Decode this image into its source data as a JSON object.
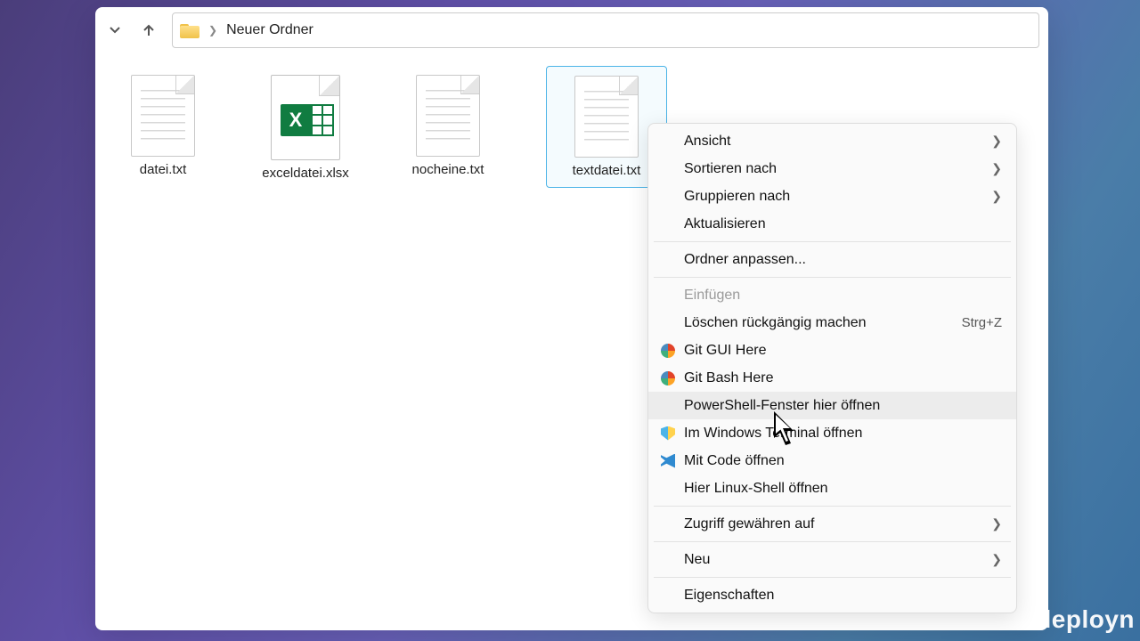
{
  "breadcrumb": {
    "folder": "Neuer Ordner"
  },
  "files": [
    {
      "name": "datei.txt",
      "kind": "txt",
      "selected": false
    },
    {
      "name": "exceldatei.xlsx",
      "kind": "xlsx",
      "selected": false
    },
    {
      "name": "nocheine.txt",
      "kind": "txt",
      "selected": false
    },
    {
      "name": "textdatei.txt",
      "kind": "txt",
      "selected": true
    }
  ],
  "context_menu": {
    "items": [
      {
        "label": "Ansicht",
        "submenu": true
      },
      {
        "label": "Sortieren nach",
        "submenu": true
      },
      {
        "label": "Gruppieren nach",
        "submenu": true
      },
      {
        "label": "Aktualisieren"
      },
      {
        "sep": true
      },
      {
        "label": "Ordner anpassen..."
      },
      {
        "sep": true
      },
      {
        "label": "Einfügen",
        "disabled": true
      },
      {
        "label": "Löschen rückgängig machen",
        "shortcut": "Strg+Z"
      },
      {
        "label": "Git GUI Here",
        "icon": "git"
      },
      {
        "label": "Git Bash Here",
        "icon": "git"
      },
      {
        "label": "PowerShell-Fenster hier öffnen",
        "hovered": true
      },
      {
        "label": "Im Windows Terminal öffnen",
        "icon": "shield"
      },
      {
        "label": "Mit Code öffnen",
        "icon": "vscode"
      },
      {
        "label": "Hier Linux-Shell öffnen"
      },
      {
        "sep": true
      },
      {
        "label": "Zugriff gewähren auf",
        "submenu": true
      },
      {
        "sep": true
      },
      {
        "label": "Neu",
        "submenu": true
      },
      {
        "sep": true
      },
      {
        "label": "Eigenschaften"
      }
    ]
  },
  "watermark_fragment": "leployn"
}
